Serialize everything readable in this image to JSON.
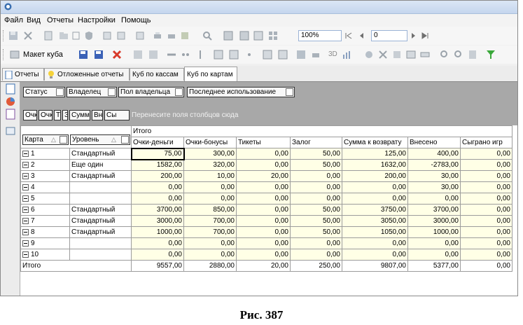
{
  "menu": [
    "Файл",
    "Вид",
    "Отчеты",
    "Настройки",
    "Помощь"
  ],
  "toolbar": {
    "zoom": "100%",
    "page": "0",
    "cube_layout": "Макет куба",
    "three_d": "3D"
  },
  "tabs": [
    "Отчеты",
    "Отложенные отчеты",
    "Куб по кассам",
    "Куб по картам"
  ],
  "filters": [
    "Статус",
    "Владелец",
    "Пол владельца",
    "Последнее использование"
  ],
  "data_fields": [
    "Очк",
    "Очк",
    "Т",
    "З",
    "Сумм",
    "Вн",
    "Сы"
  ],
  "drop_hint": "Перенесите поля столбцов сюда",
  "grid": {
    "total_header": "Итого",
    "row_headers": [
      "Карта",
      "Уровень"
    ],
    "columns": [
      "Очки-деньги",
      "Очки-бонусы",
      "Тикеты",
      "Залог",
      "Сумма к возврату",
      "Внесено",
      "Сыграно игр"
    ],
    "rows": [
      {
        "card": "1",
        "level": "Стандартный",
        "values": [
          "75,00",
          "300,00",
          "0,00",
          "50,00",
          "125,00",
          "400,00",
          "0,00"
        ]
      },
      {
        "card": "2",
        "level": "Еще один",
        "values": [
          "1582,00",
          "320,00",
          "0,00",
          "50,00",
          "1632,00",
          "-2783,00",
          "0,00"
        ]
      },
      {
        "card": "3",
        "level": "Стандартный",
        "values": [
          "200,00",
          "10,00",
          "20,00",
          "0,00",
          "200,00",
          "30,00",
          "0,00"
        ]
      },
      {
        "card": "4",
        "level": "",
        "values": [
          "0,00",
          "0,00",
          "0,00",
          "0,00",
          "0,00",
          "30,00",
          "0,00"
        ]
      },
      {
        "card": "5",
        "level": "",
        "values": [
          "0,00",
          "0,00",
          "0,00",
          "0,00",
          "0,00",
          "0,00",
          "0,00"
        ]
      },
      {
        "card": "6",
        "level": "Стандартный",
        "values": [
          "3700,00",
          "850,00",
          "0,00",
          "50,00",
          "3750,00",
          "3700,00",
          "0,00"
        ]
      },
      {
        "card": "7",
        "level": "Стандартный",
        "values": [
          "3000,00",
          "700,00",
          "0,00",
          "50,00",
          "3050,00",
          "3000,00",
          "0,00"
        ]
      },
      {
        "card": "8",
        "level": "Стандартный",
        "values": [
          "1000,00",
          "700,00",
          "0,00",
          "50,00",
          "1050,00",
          "1000,00",
          "0,00"
        ]
      },
      {
        "card": "9",
        "level": "",
        "values": [
          "0,00",
          "0,00",
          "0,00",
          "0,00",
          "0,00",
          "0,00",
          "0,00"
        ]
      },
      {
        "card": "10",
        "level": "",
        "values": [
          "0,00",
          "0,00",
          "0,00",
          "0,00",
          "0,00",
          "0,00",
          "0,00"
        ]
      }
    ],
    "total_label": "Итого",
    "totals": [
      "9557,00",
      "2880,00",
      "20,00",
      "250,00",
      "9807,00",
      "5377,00",
      "0,00"
    ]
  },
  "caption": "Рис. 387",
  "colors": {
    "cell_bg": "#ffffe6",
    "header_area": "#a8a8a8",
    "titlebar": "#c5d6ee"
  }
}
